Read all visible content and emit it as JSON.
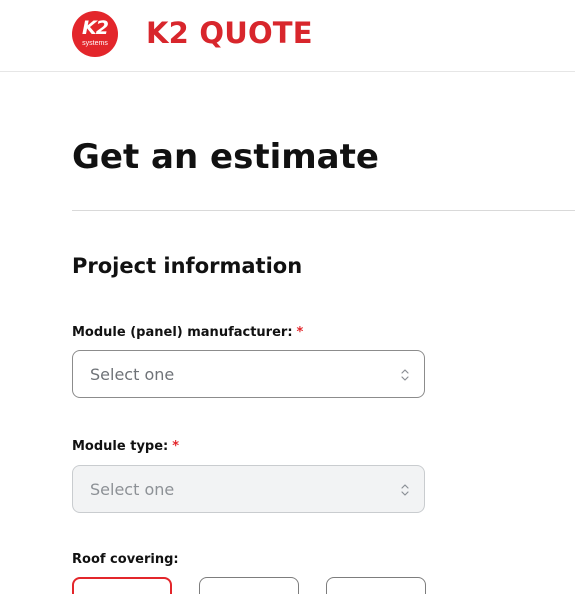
{
  "header": {
    "logo": {
      "text": "K2",
      "subtext": "systems",
      "icon": "k2-logo-icon"
    },
    "brand": "K2 QUOTE"
  },
  "main": {
    "title": "Get an estimate",
    "section_title": "Project information",
    "fields": [
      {
        "label": "Module (panel) manufacturer:",
        "required": "*",
        "placeholder": "Select one",
        "disabled": false
      },
      {
        "label": "Module type:",
        "required": "*",
        "placeholder": "Select one",
        "disabled": true
      }
    ],
    "roof_covering": {
      "label": "Roof covering:",
      "selected_index": 0
    }
  },
  "colors": {
    "brand_red": "#e3262b",
    "text": "#111111",
    "border": "#8c8c8c",
    "disabled_bg": "#f2f3f4"
  }
}
